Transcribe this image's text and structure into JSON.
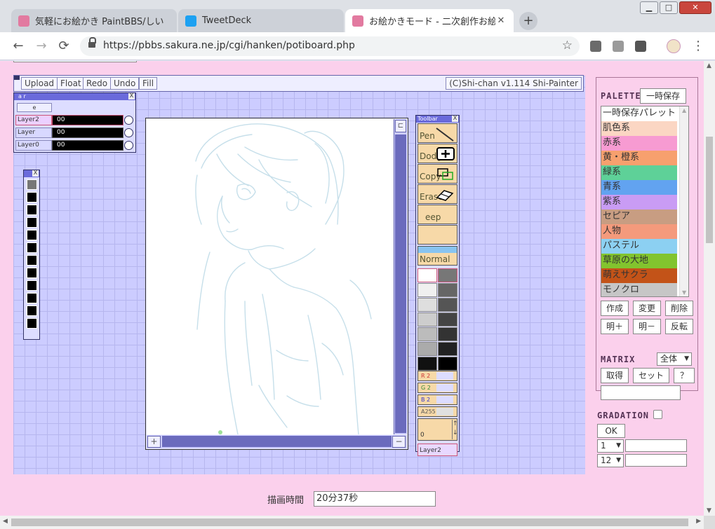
{
  "browser": {
    "tabs": [
      {
        "title": "気軽にお絵かき PaintBBS/しい",
        "favicon_color": "#e27aa0",
        "active": false
      },
      {
        "title": "TweetDeck",
        "favicon_color": "#1da1f2",
        "active": false
      },
      {
        "title": "お絵かきモード - 二次創作お絵",
        "favicon_color": "#e27aa0",
        "active": true
      }
    ],
    "new_tab": "+",
    "window_controls": {
      "minimize": "▁",
      "maximize": "□",
      "close": "✕"
    },
    "nav": {
      "back": "←",
      "forward": "→",
      "reload": "⟳"
    },
    "url": "https://pbbs.sakura.ne.jp/cgi/hanken/potiboard.php",
    "bookmark": "☆",
    "menu": "⋮"
  },
  "applet": {
    "menu": {
      "upload": "Upload",
      "float": "Float",
      "redo": "Redo",
      "undo": "Undo",
      "fill": "Fill",
      "credit": "(C)Shi-chan v1.114 Shi-Painter"
    },
    "layer_panel": {
      "title": "a  r",
      "close": "X",
      "button": "e",
      "layers": [
        {
          "name": "Layer2",
          "value": "00",
          "selected": true
        },
        {
          "name": "Layer",
          "value": "00",
          "selected": false
        },
        {
          "name": "Layer0",
          "value": "00",
          "selected": false
        }
      ]
    },
    "swatch_panel": {
      "close": "X"
    },
    "canvas": {
      "corner": "⊏",
      "plus": "+",
      "minus": "−"
    },
    "toolbar": {
      "title": "Toolbar",
      "close": "X",
      "tools": [
        "Pen",
        "Dodge",
        "Copy",
        "Erase",
        "eep",
        ""
      ],
      "blend": "Normal",
      "grays_left": [
        "#ffffff",
        "#f0f0f0",
        "#dedede",
        "#cdcdcd",
        "#bcbcbc",
        "#ababab",
        "#111111"
      ],
      "grays_right": [
        "#777777",
        "#666666",
        "#555555",
        "#444444",
        "#333333",
        "#222222",
        "#000000"
      ],
      "sliders": [
        {
          "label": "R  2",
          "color": "#f0a0a0"
        },
        {
          "label": "G  2",
          "color": "#a0e0a0"
        },
        {
          "label": "B  2",
          "color": "#a0a0f0"
        },
        {
          "label": "A255",
          "color": "#cccccc"
        }
      ],
      "size_value": "0",
      "size_up": "↑",
      "size_down": "↓",
      "current_layer": "Layer2"
    }
  },
  "palette": {
    "title": "PALETTE",
    "save_button": "一時保存",
    "items": [
      {
        "label": "一時保存パレット",
        "color": "#ffffff"
      },
      {
        "label": "肌色系",
        "color": "#fbd6c3"
      },
      {
        "label": "赤系",
        "color": "#f79bd2"
      },
      {
        "label": "黄・橙系",
        "color": "#f7a06e"
      },
      {
        "label": "緑系",
        "color": "#5ed198"
      },
      {
        "label": "青系",
        "color": "#62a3f0"
      },
      {
        "label": "紫系",
        "color": "#c99cf4"
      },
      {
        "label": "セピア",
        "color": "#c89d82"
      },
      {
        "label": "人物",
        "color": "#f49a7c"
      },
      {
        "label": "パステル",
        "color": "#8cd0f2"
      },
      {
        "label": "草原の大地",
        "color": "#82c42e"
      },
      {
        "label": "萌えサクラ",
        "color": "#c35318"
      },
      {
        "label": "モノクロ",
        "color": "#c6c6c6"
      }
    ],
    "buttons_row1": [
      "作成",
      "変更",
      "削除"
    ],
    "buttons_row2": [
      "明＋",
      "明－",
      "反転"
    ],
    "matrix_title": "MATRIX",
    "matrix_select": "全体",
    "matrix_buttons": [
      "取得",
      "セット",
      "？"
    ]
  },
  "gradation": {
    "title": "GRADATION",
    "ok": "OK",
    "select1": "1",
    "select2": "12"
  },
  "draw_time": {
    "label": "描画時間",
    "value": "20分37秒"
  }
}
